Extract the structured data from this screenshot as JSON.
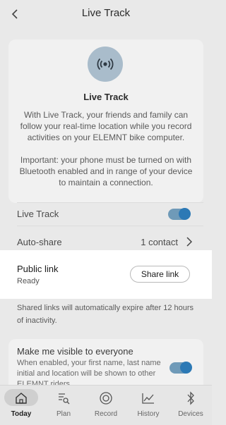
{
  "header": {
    "title": "Live Track",
    "back_icon": "chevron-left-icon"
  },
  "intro": {
    "icon": "bluetooth-broadcast-icon",
    "title": "Live Track",
    "description": "With Live Track, your friends and family can follow your real-time location while you record activities on your ELEMNT bike computer.",
    "important": "Important: your phone must be turned on with Bluetooth enabled and in range of your device to maintain a connection."
  },
  "settings": {
    "live_track": {
      "label": "Live Track",
      "enabled": true
    },
    "auto_share": {
      "label": "Auto-share",
      "value": "1 contact"
    }
  },
  "public_link": {
    "label": "Public link",
    "status": "Ready",
    "button_label": "Share link"
  },
  "expire_note": "Shared links will automatically expire after 12 hours of inactivity.",
  "visibility": {
    "title": "Make me visible to everyone",
    "description": "When enabled, your first name, last name initial and location will be shown to other ELEMNT riders.",
    "enabled": true
  },
  "tabs": [
    {
      "label": "Today",
      "icon": "home-icon",
      "active": true
    },
    {
      "label": "Plan",
      "icon": "plan-icon",
      "active": false
    },
    {
      "label": "Record",
      "icon": "record-icon",
      "active": false
    },
    {
      "label": "History",
      "icon": "history-icon",
      "active": false
    },
    {
      "label": "Devices",
      "icon": "bluetooth-icon",
      "active": false
    }
  ],
  "colors": {
    "accent": "#2c79b5",
    "toggle_track": "#6f9ab8",
    "icon_circle": "#a9bccb",
    "dim_background": "#e9e9e9"
  }
}
